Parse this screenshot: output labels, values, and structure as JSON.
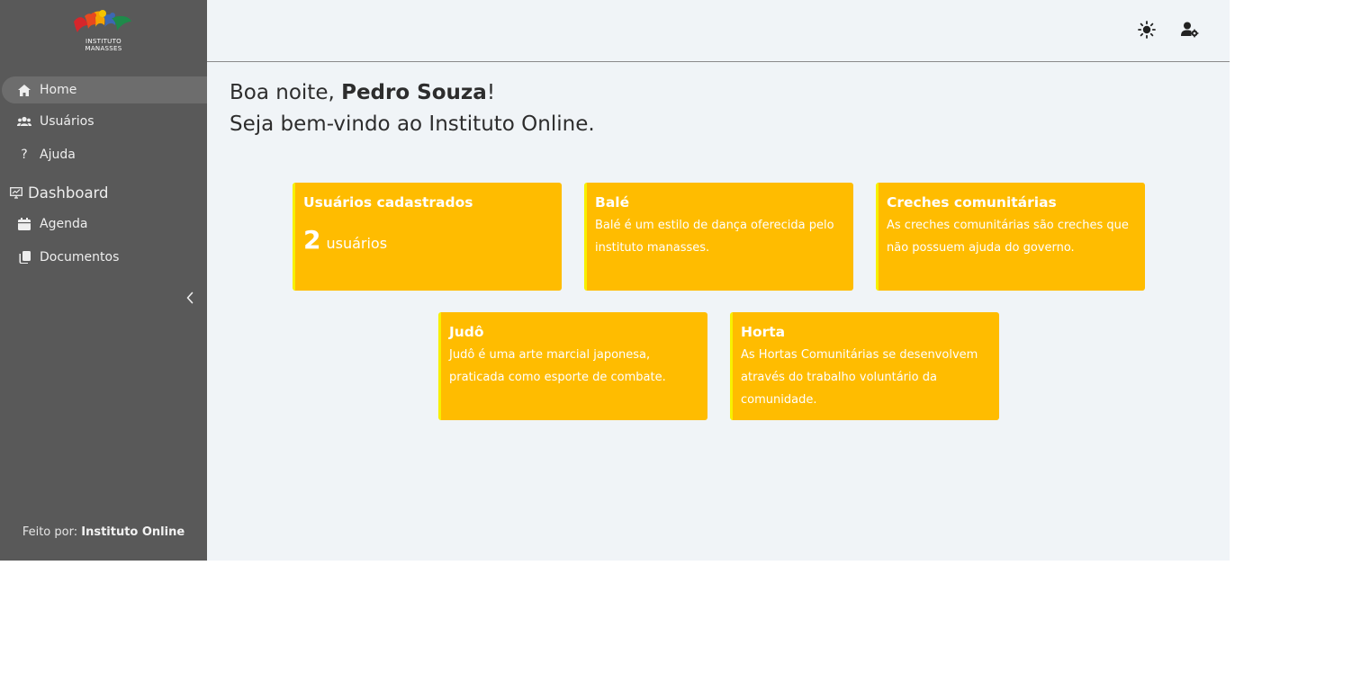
{
  "sidebar": {
    "logo_text": [
      "INSTITUTO",
      "MANASSES"
    ],
    "items": [
      {
        "label": "Home",
        "icon": "home-icon",
        "active": true
      },
      {
        "label": "Usuários",
        "icon": "users-icon"
      },
      {
        "label": "Ajuda",
        "icon": "question-icon"
      }
    ],
    "section": {
      "label": "Dashboard",
      "icon": "monitor-chart-icon"
    },
    "section_items": [
      {
        "label": "Agenda",
        "icon": "calendar-icon"
      },
      {
        "label": "Documentos",
        "icon": "documents-icon"
      }
    ],
    "footer_prefix": "Feito por:",
    "footer_brand": "Instituto Online"
  },
  "topbar": {
    "theme_icon": "sun-icon",
    "user_settings_icon": "user-gear-icon"
  },
  "greeting": {
    "prefix": "Boa noite, ",
    "name": "Pedro Souza",
    "suffix": "!",
    "line2": "Seja bem-vindo ao Instituto Online."
  },
  "cards": [
    {
      "title": "Usuários cadastrados",
      "count": "2",
      "unit": "usuários"
    },
    {
      "title": "Balé",
      "text": "Balé é um estilo de dança oferecida pelo instituto manasses."
    },
    {
      "title": "Creches comunitárias",
      "text": "As creches comunitárias são creches que não possuem ajuda do governo."
    },
    {
      "title": "Judô",
      "text": "Judô é uma arte marcial japonesa, praticada como esporte de combate."
    },
    {
      "title": "Horta",
      "text": "As Hortas Comunitárias se desenvolvem através do trabalho voluntário da comunidade."
    }
  ],
  "colors": {
    "sidebar_bg": "#595959",
    "main_bg": "#f0f4f7",
    "card_bg": "#ffbc00",
    "card_border": "#f7f000"
  }
}
